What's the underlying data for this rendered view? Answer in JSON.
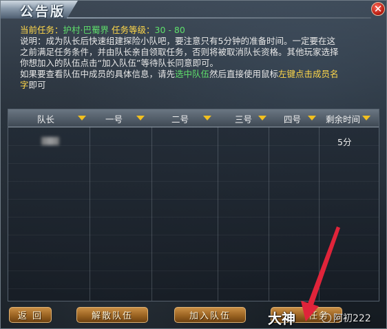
{
  "window": {
    "title": "公告版",
    "close_symbol": "✕"
  },
  "description": {
    "task_label": "当前任务：",
    "task_name": "护村·巴蜀界",
    "level_label": "任务等级：",
    "level_range": "30 - 80",
    "line2": "说明：成为队长后快速组建探险小队吧，要注意只有5分钟的准备时间。一定要在这",
    "line3": "之前满足任务条件，并由队长亲自领取任务，否则将被取消队长资格。其他玩家选择",
    "line4": "你想加入的队伍点击“加入队伍”等待队长同意即可。",
    "line5_a": "如果要查看队伍中成员的具体信息，请先",
    "line5_b": "选中队伍",
    "line5_c": "然后直接使用鼠标",
    "line5_d": "左键点击成员名",
    "line6_a": "字",
    "line6_b": "即可"
  },
  "table": {
    "headers": [
      "队长",
      "一号",
      "二号",
      "三号",
      "四号",
      "剩余时间"
    ],
    "rows": [
      {
        "time_left": "5分"
      }
    ]
  },
  "buttons": {
    "back": "返 回",
    "disband": "解散队伍",
    "join": "加入队伍",
    "accept_task": "任务"
  },
  "watermarks": {
    "left": "大神",
    "right": "阿初222"
  },
  "colors": {
    "highlight_green": "#5fe06c",
    "highlight_yellow": "#ffd84a",
    "arrow_red": "#e0243a",
    "button_gold": "#b47a33"
  }
}
